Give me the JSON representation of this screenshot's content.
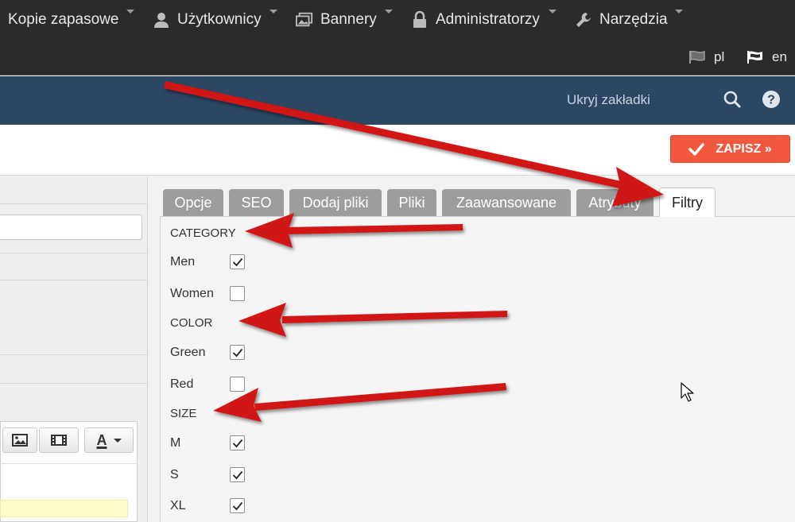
{
  "nav": {
    "items": [
      {
        "label": "Kopie zapasowe",
        "icon": "none"
      },
      {
        "label": "Użytkownicy",
        "icon": "user-icon"
      },
      {
        "label": "Bannery",
        "icon": "images-icon"
      },
      {
        "label": "Administratorzy",
        "icon": "lock-icon"
      },
      {
        "label": "Narzędzia",
        "icon": "wrench-icon"
      }
    ],
    "languages": [
      {
        "label": "pl",
        "icon": "flag-icon"
      },
      {
        "label": "en",
        "icon": "flag-icon"
      }
    ]
  },
  "header": {
    "hide_tabs_label": "Ukryj zakładki",
    "search_icon": "search-icon",
    "help_icon": "help-icon"
  },
  "actions": {
    "save_label": "ZAPISZ »",
    "save_icon": "check-icon"
  },
  "editor_toolbar": {
    "icons": [
      "image-icon",
      "video-icon",
      "text-color-icon"
    ],
    "text_color_label": "A"
  },
  "tabs": [
    {
      "label": "Opcje",
      "active": false
    },
    {
      "label": "SEO",
      "active": false
    },
    {
      "label": "Dodaj pliki",
      "active": false
    },
    {
      "label": "Pliki",
      "active": false
    },
    {
      "label": "Zaawansowane",
      "active": false
    },
    {
      "label": "Atrybuty",
      "active": false
    },
    {
      "label": "Filtry",
      "active": true
    }
  ],
  "filters": {
    "category": {
      "title": "CATEGORY",
      "options": [
        {
          "label": "Men",
          "checked": true
        },
        {
          "label": "Women",
          "checked": false
        }
      ]
    },
    "color": {
      "title": "COLOR",
      "options": [
        {
          "label": "Green",
          "checked": true
        },
        {
          "label": "Red",
          "checked": false
        }
      ]
    },
    "size": {
      "title": "SIZE",
      "options": [
        {
          "label": "M",
          "checked": true
        },
        {
          "label": "S",
          "checked": true
        },
        {
          "label": "XL",
          "checked": true
        }
      ]
    }
  },
  "colors": {
    "nav_bg": "#2b2b2b",
    "header_bg": "#2c4763",
    "save_button": "#f2583e",
    "tab_inactive": "#9d9d9d",
    "annotation_arrow": "#d11515"
  }
}
